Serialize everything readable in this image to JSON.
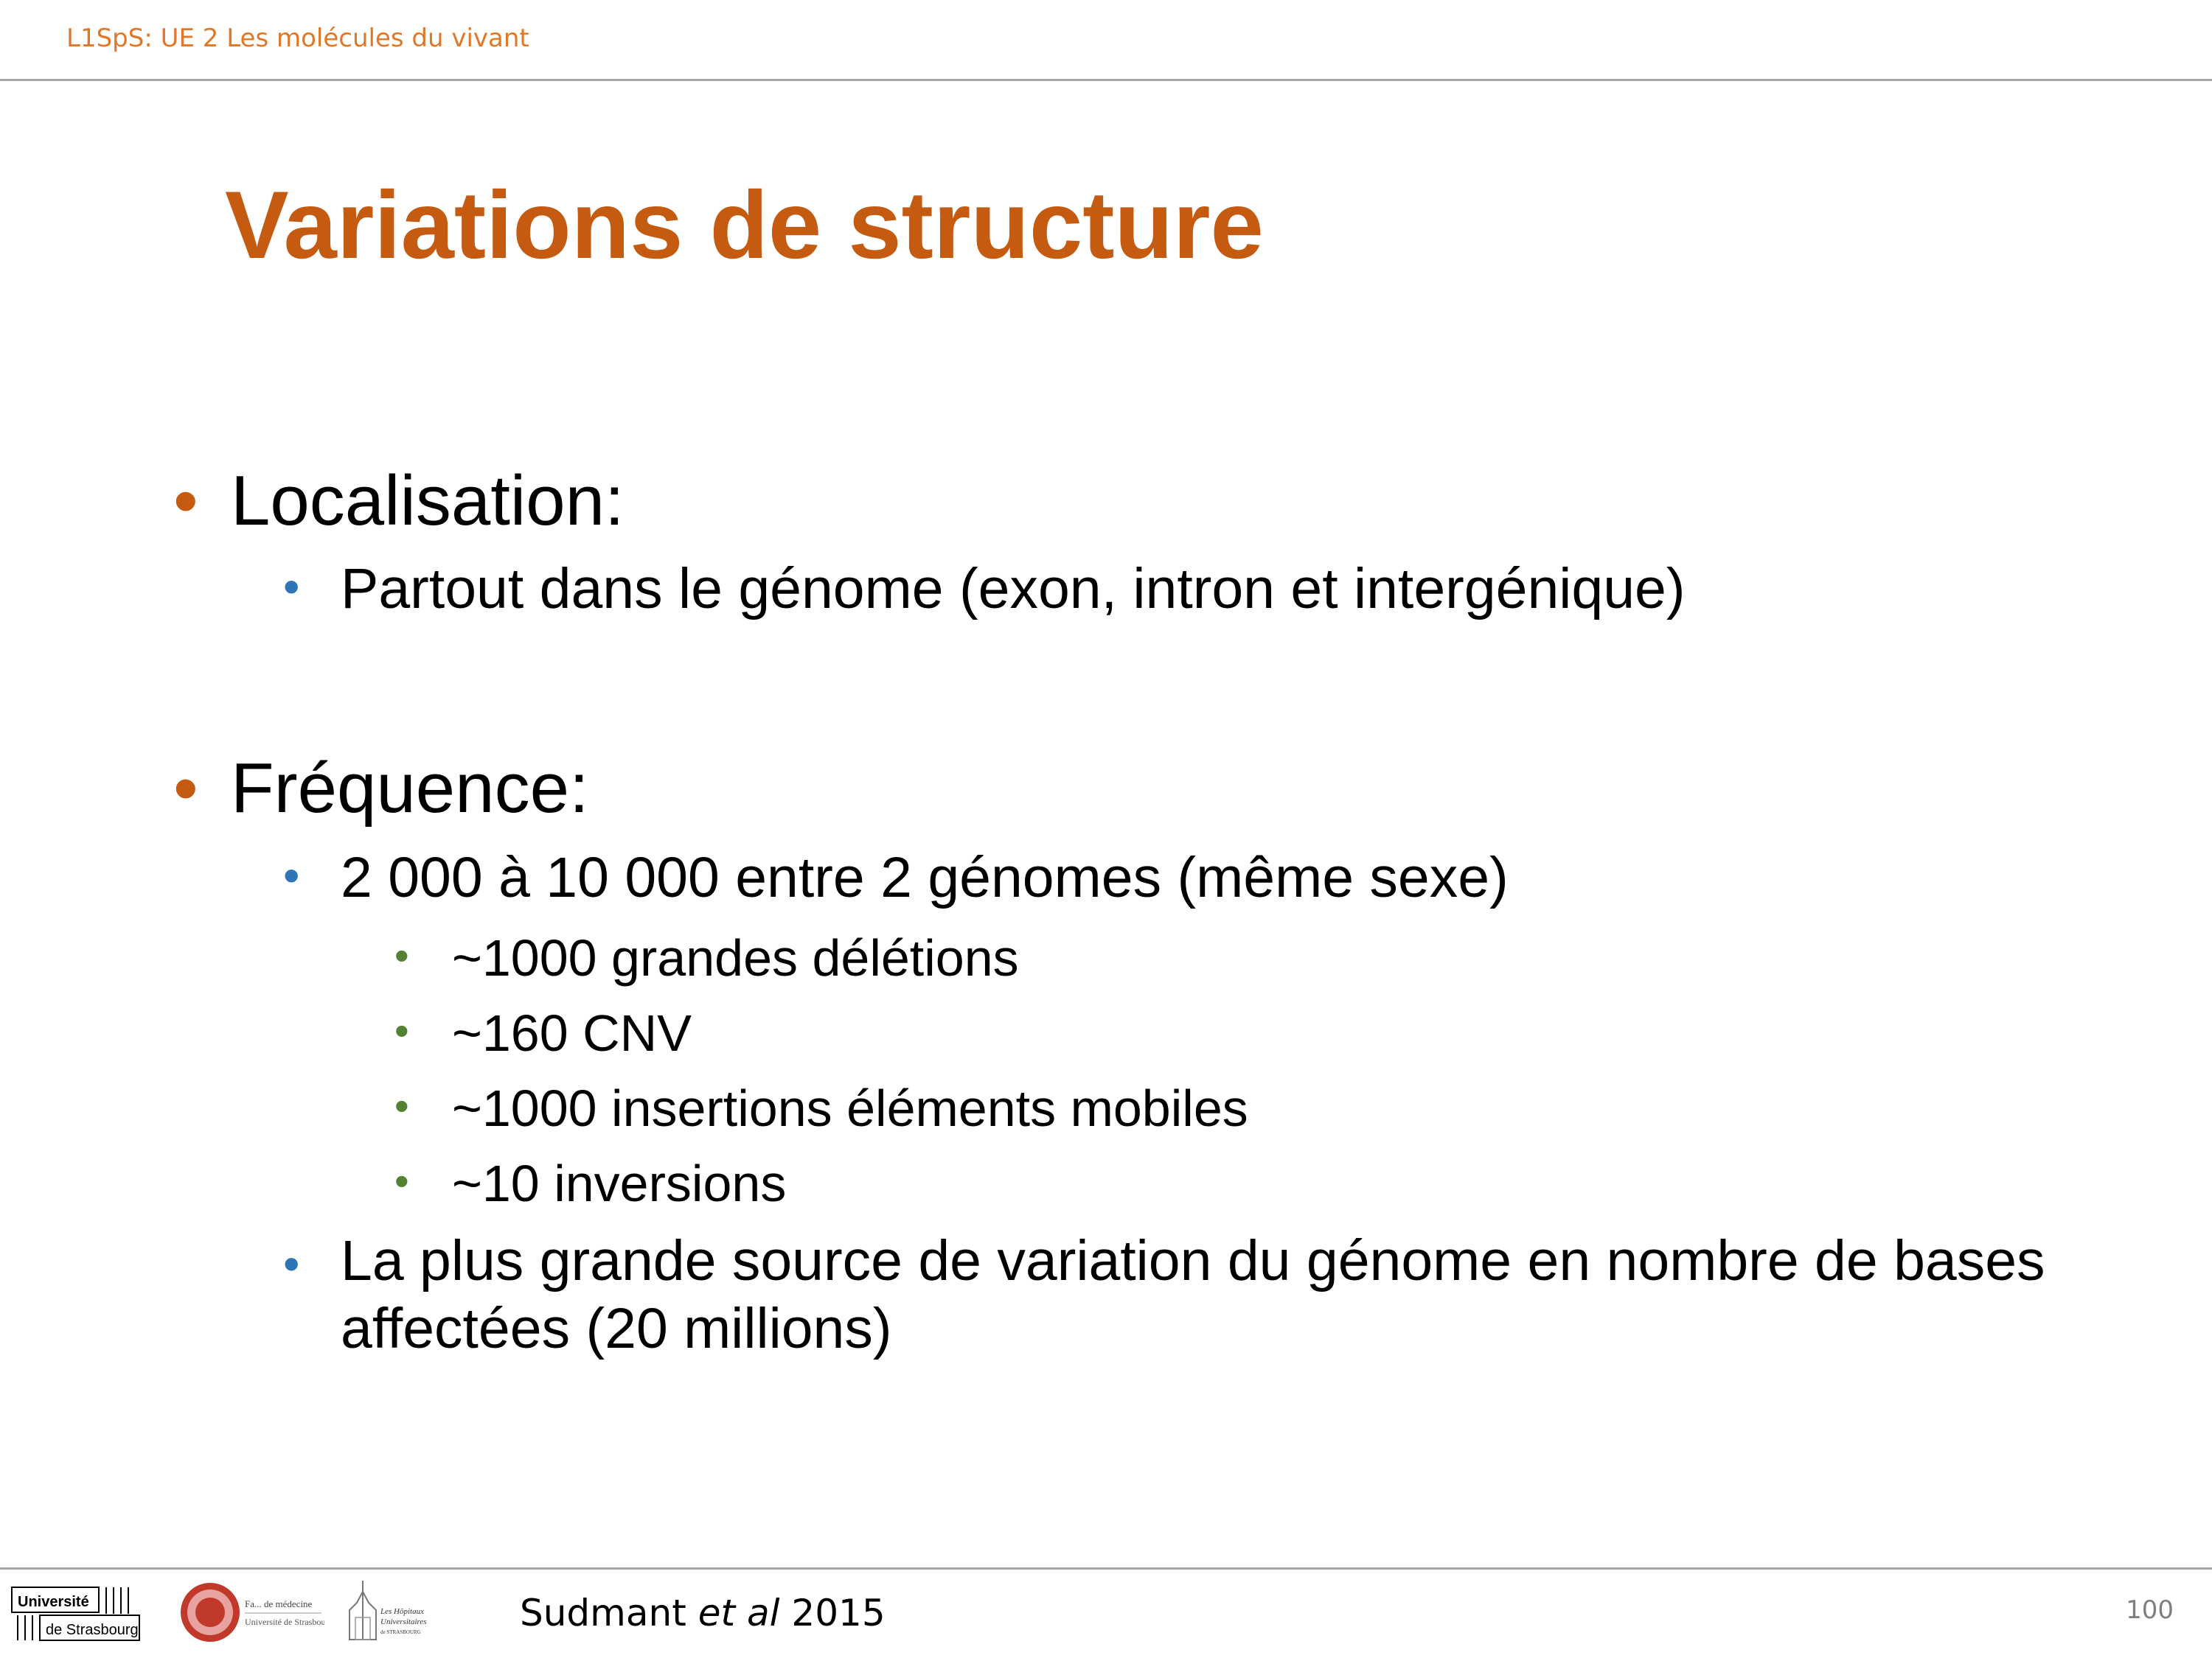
{
  "header": {
    "course": "L1SpS: UE 2 Les molécules du vivant"
  },
  "slide": {
    "title": "Variations de structure",
    "bullets": [
      {
        "label": "Localisation:",
        "sub": [
          {
            "text": "Partout dans le génome (exon, intron et intergénique)"
          }
        ]
      },
      {
        "label": "Fréquence:",
        "sub": [
          {
            "text": "2 000 à 10 000 entre 2 génomes (même sexe)",
            "items": [
              "~1000 grandes délétions",
              "~160 CNV",
              "~1000 insertions éléments mobiles",
              "~10 inversions"
            ]
          },
          {
            "text": "La plus grande source de variation du génome en nombre de bases affectées (20 millions)"
          }
        ]
      }
    ]
  },
  "footer": {
    "citation_author": "Sudmant",
    "citation_etal": "et al",
    "citation_year": "2015",
    "page_number": "100",
    "logos": {
      "unistra_line1": "Université",
      "unistra_line2": "de Strasbourg",
      "seal_line1": "Fa... de médecine",
      "seal_line2": "Université de Strasbourg",
      "hopitaux_line1": "Les Hôpitaux",
      "hopitaux_line2": "Universitaires",
      "hopitaux_line3": "de STRASBOURG"
    }
  },
  "colors": {
    "title": "#c55a11",
    "header": "#e0782a",
    "bullet_l1": "#c55a11",
    "bullet_l2": "#2e75b6",
    "bullet_l3": "#548235",
    "rule": "#a6a6a6"
  }
}
